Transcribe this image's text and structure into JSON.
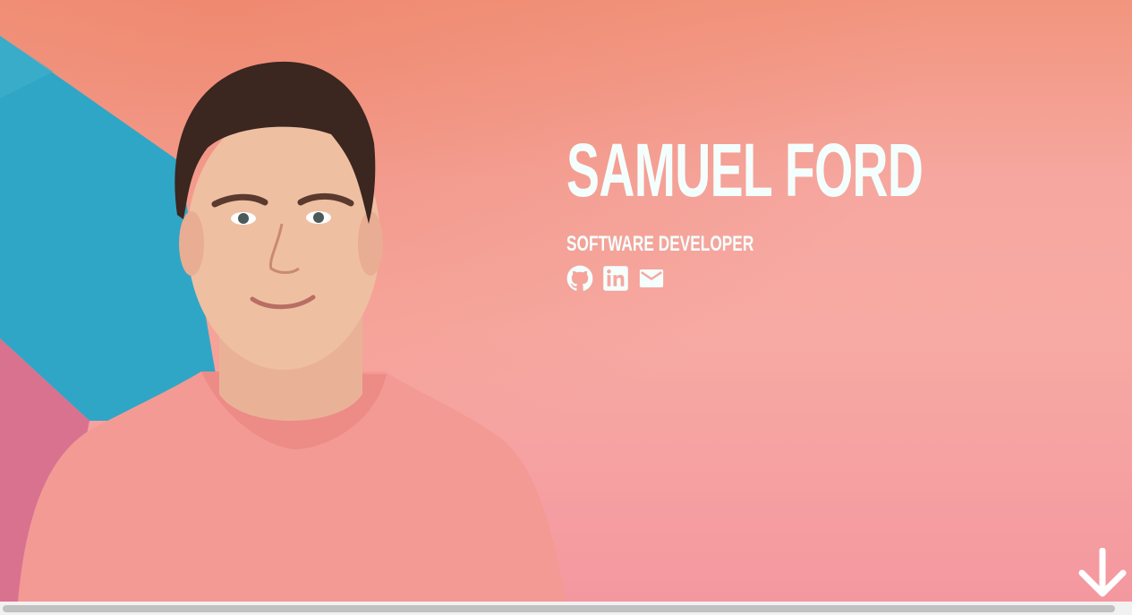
{
  "hero": {
    "name": "SAMUEL FORD",
    "role": "SOFTWARE DEVELOPER",
    "portrait_label": "portrait photo",
    "socials": [
      {
        "icon": "github-icon"
      },
      {
        "icon": "linkedin-icon"
      },
      {
        "icon": "mail-icon"
      }
    ],
    "scroll_icon": "arrow-down-icon"
  },
  "colors": {
    "background": "#f7aaa3",
    "accent_blue": "#2fa6c6",
    "text": "#f4fffd",
    "shirt": "#f39a95"
  }
}
